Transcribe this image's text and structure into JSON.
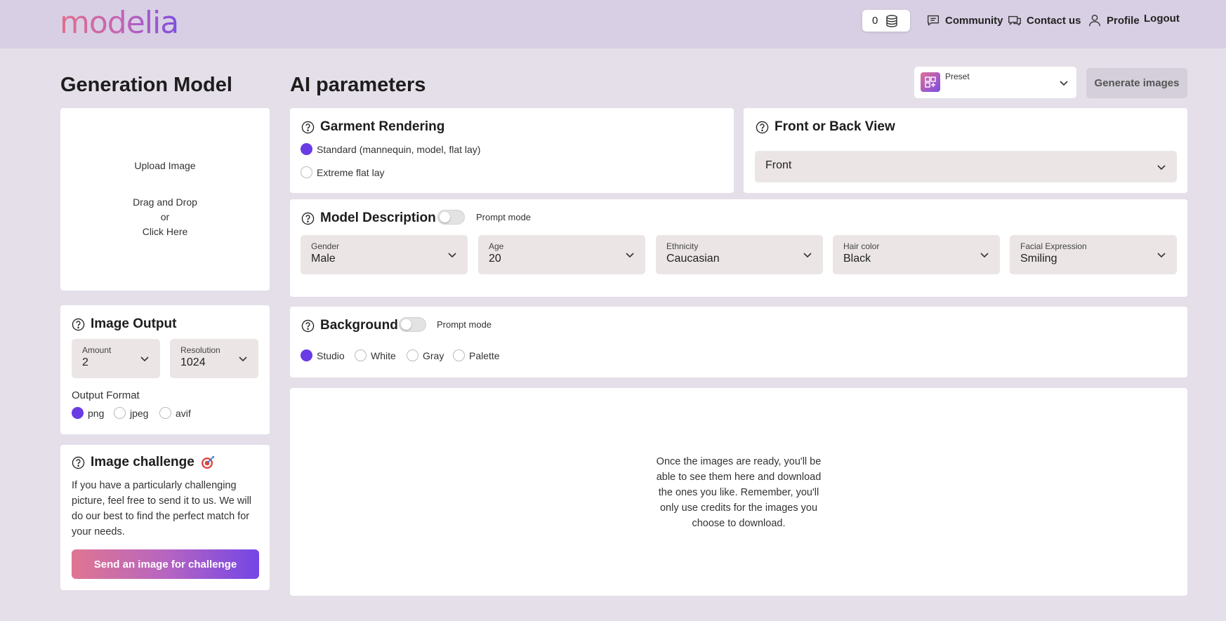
{
  "header": {
    "logo": "modelia",
    "credits": "0",
    "nav": {
      "community": "Community",
      "contact": "Contact us",
      "profile": "Profile",
      "logout": "Logout"
    }
  },
  "left": {
    "title": "Generation Model",
    "upload": {
      "label": "Upload Image",
      "drag": "Drag and Drop",
      "or": "or",
      "click": "Click Here"
    },
    "image_output": {
      "title": "Image Output",
      "amount": {
        "label": "Amount",
        "value": "2"
      },
      "resolution": {
        "label": "Resolution",
        "value": "1024"
      },
      "format_label": "Output Format",
      "formats": [
        "png",
        "jpeg",
        "avif"
      ],
      "selected_format": "png"
    },
    "challenge": {
      "title": "Image challenge",
      "text": "If you have a particularly challenging picture, feel free to send it to us. We will do our best to find the perfect match for your needs.",
      "button": "Send an image for challenge"
    }
  },
  "main": {
    "title": "AI parameters",
    "preset_label": "Preset",
    "generate_button": "Generate images",
    "garment": {
      "title": "Garment Rendering",
      "options": [
        "Standard (mannequin, model, flat lay)",
        "Extreme flat lay"
      ],
      "selected": "Standard (mannequin, model, flat lay)"
    },
    "view": {
      "title": "Front or Back View",
      "value": "Front"
    },
    "model": {
      "title": "Model Description",
      "prompt_mode": "Prompt mode",
      "fields": [
        {
          "label": "Gender",
          "value": "Male"
        },
        {
          "label": "Age",
          "value": "20"
        },
        {
          "label": "Ethnicity",
          "value": "Caucasian"
        },
        {
          "label": "Hair color",
          "value": "Black"
        },
        {
          "label": "Facial Expression",
          "value": "Smiling"
        }
      ]
    },
    "background": {
      "title": "Background",
      "prompt_mode": "Prompt mode",
      "options": [
        "Studio",
        "White",
        "Gray",
        "Palette"
      ],
      "selected": "Studio"
    },
    "results_hint": "Once the images are ready, you'll be able to see them here and download the ones you like. Remember, you'll only use credits for the images you choose to download."
  },
  "colors": {
    "accent": "#6a3be4",
    "header_bg": "#d8cfe4",
    "page_bg": "#e4dfe9"
  }
}
